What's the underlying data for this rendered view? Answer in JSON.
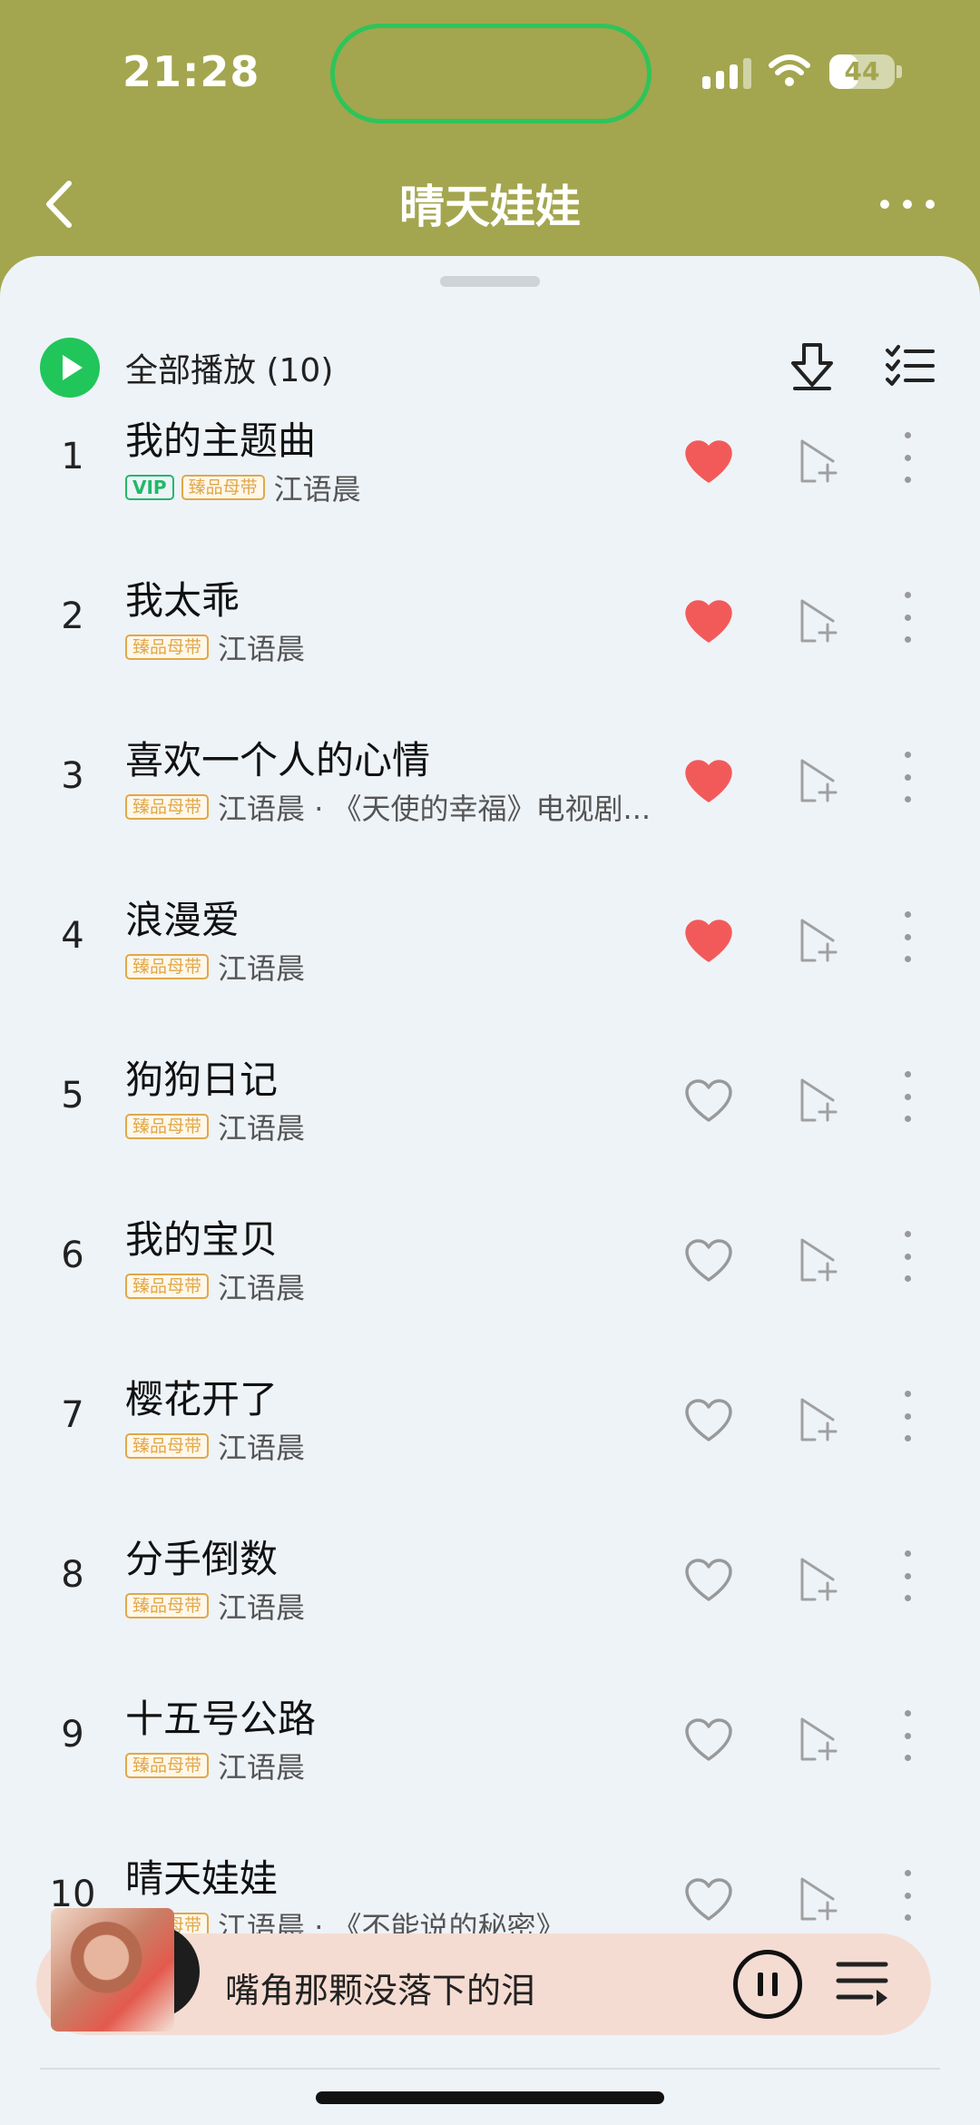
{
  "status_bar": {
    "time": "21:28",
    "battery": "44",
    "battery_level": 0.44
  },
  "nav": {
    "title": "晴天娃娃"
  },
  "toolbar": {
    "play_all_label": "全部播放",
    "count": "(10)"
  },
  "songs": [
    {
      "index": "1",
      "title": "我的主题曲",
      "vip": "VIP",
      "badge": "臻品母带",
      "artist": "江语晨",
      "liked": true
    },
    {
      "index": "2",
      "title": "我太乖",
      "badge": "臻品母带",
      "artist": "江语晨",
      "liked": true
    },
    {
      "index": "3",
      "title": "喜欢一个人的心情",
      "badge": "臻品母带",
      "artist": "江语晨 · 《天使的幸福》电视剧...",
      "liked": true
    },
    {
      "index": "4",
      "title": "浪漫爱",
      "badge": "臻品母带",
      "artist": "江语晨",
      "liked": true
    },
    {
      "index": "5",
      "title": "狗狗日记",
      "badge": "臻品母带",
      "artist": "江语晨",
      "liked": false
    },
    {
      "index": "6",
      "title": "我的宝贝",
      "badge": "臻品母带",
      "artist": "江语晨",
      "liked": false
    },
    {
      "index": "7",
      "title": "樱花开了",
      "badge": "臻品母带",
      "artist": "江语晨",
      "liked": false
    },
    {
      "index": "8",
      "title": "分手倒数",
      "badge": "臻品母带",
      "artist": "江语晨",
      "liked": false
    },
    {
      "index": "9",
      "title": "十五号公路",
      "badge": "臻品母带",
      "artist": "江语晨",
      "liked": false
    },
    {
      "index": "10",
      "title": "晴天娃娃",
      "badge": "臻品母带",
      "artist": "江语晨 · 《不能说的秘密》",
      "liked": false
    }
  ],
  "player": {
    "now_playing": "嘴角那颗没落下的泪"
  },
  "colors": {
    "header": "#a3a64e",
    "accent_green": "#20c65a",
    "heart_red": "#f25a5a",
    "badge_gold": "#e0a84a",
    "background": "#eef3f8"
  },
  "icons": [
    "back-icon",
    "more-icon",
    "play-icon",
    "download-icon",
    "multiselect-icon",
    "heart-icon",
    "add-to-playlist-icon",
    "pause-icon",
    "playlist-queue-icon"
  ]
}
